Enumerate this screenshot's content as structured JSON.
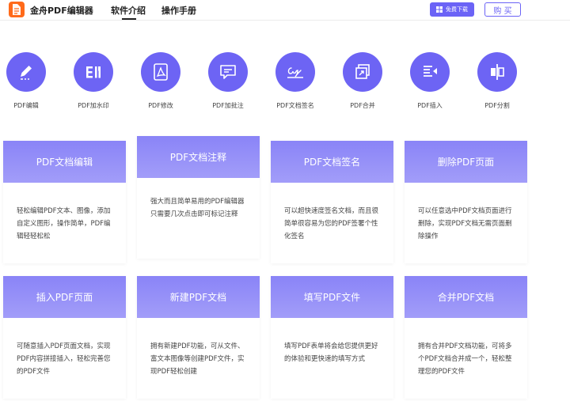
{
  "header": {
    "app_name": "金舟PDF编辑器",
    "nav": [
      {
        "label": "软件介绍",
        "active": true
      },
      {
        "label": "操作手册",
        "active": false
      }
    ],
    "download_label": "免费下载",
    "buy_label": "购 买"
  },
  "features": [
    {
      "label": "PDF编辑",
      "icon": "pencil-icon"
    },
    {
      "label": "PDF加水印",
      "icon": "watermark-icon"
    },
    {
      "label": "PDF修改",
      "icon": "pdf-icon"
    },
    {
      "label": "PDF加批注",
      "icon": "comment-icon"
    },
    {
      "label": "PDF文档签名",
      "icon": "signature-icon"
    },
    {
      "label": "PDF合并",
      "icon": "merge-icon"
    },
    {
      "label": "PDF插入",
      "icon": "insert-icon"
    },
    {
      "label": "PDF分割",
      "icon": "split-icon"
    }
  ],
  "cards": [
    {
      "title": "PDF文档编辑",
      "desc": "轻松编辑PDF文本、图像，添加自定义图形，操作简单，PDF编辑轻轻松松"
    },
    {
      "title": "PDF文档注释",
      "desc": "强大而且简单易用的PDF编辑器只需要几次点击即可标记注释"
    },
    {
      "title": "PDF文档签名",
      "desc": "可以超快速度签名文档，而且很简单很容易为您的PDF签署个性化签名"
    },
    {
      "title": "删除PDF页面",
      "desc": "可以任意选中PDF文档页面进行删除，实现PDF文档无需页面删除操作"
    },
    {
      "title": "插入PDF页面",
      "desc": "可随意插入PDF页面文档，实现PDF内容拼接插入，轻松完善您的PDF文件"
    },
    {
      "title": "新建PDF文档",
      "desc": "拥有新建PDF功能，可从文件、富文本图像等创建PDF文件，实现PDF轻松创建"
    },
    {
      "title": "填写PDF文件",
      "desc": "填写PDF表单将会给您提供更好的体验和更快速的填写方式"
    },
    {
      "title": "合并PDF文档",
      "desc": "拥有合并PDF文档功能，可将多个PDF文档合并成一个，轻松整理您的PDF文件"
    }
  ],
  "colors": {
    "accent": "#6b63f6",
    "icon_bg": "#6d64f4",
    "card_head": "#8a84f7"
  }
}
